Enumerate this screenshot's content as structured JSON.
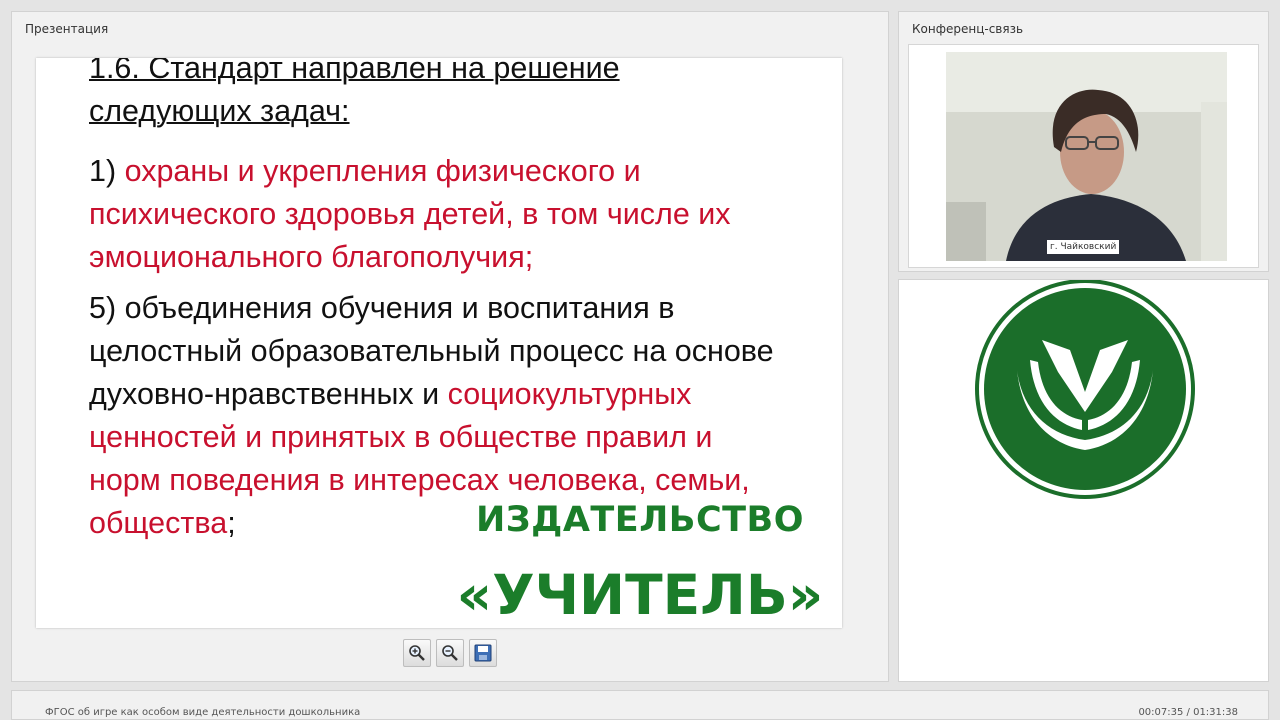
{
  "presentation": {
    "panel_title": "Презентация",
    "slide": {
      "heading": "1.6. Стандарт направлен на решение следующих задач:",
      "item1_number": "1) ",
      "item1_text": "охраны и укрепления физического и психического здоровья детей, в том числе их эмоционального благополучия;",
      "item5_black": "5) объединения обучения и воспитания в целостный образовательный процесс на основе духовно-нравственных и ",
      "item5_red": "социокультурных ценностей и принятых в обществе правил и норм поведения в интересах человека, семьи, общества",
      "item5_end": ";",
      "colors": {
        "text": "#111111",
        "highlight": "#c8102e"
      }
    },
    "toolbar": {
      "buttons": [
        {
          "icon": "zoom-in-icon"
        },
        {
          "icon": "zoom-out-icon"
        },
        {
          "icon": "save-icon"
        }
      ]
    }
  },
  "conference": {
    "panel_title": "Конференц-связь",
    "video_label": "г. Чайковский"
  },
  "publisher": {
    "line1": "ИЗДАТЕЛЬСТВО",
    "line2": "«УЧИТЕЛЬ»",
    "brand_color": "#1b7d2a"
  },
  "status": {
    "webinar_title": "ФГОС об игре как особом виде деятельности дошкольника",
    "timecode": "00:07:35 / 01:31:38"
  }
}
